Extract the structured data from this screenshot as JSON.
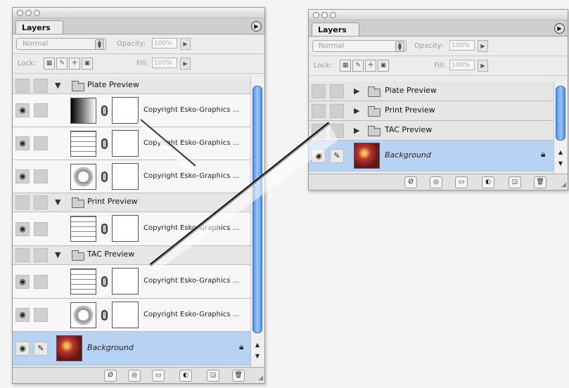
{
  "left_panel": {
    "tab": "Layers",
    "blend_mode": "Normal",
    "opacity_label": "Opacity:",
    "opacity_value": "100%",
    "lock_label": "Lock:",
    "fill_label": "Fill:",
    "fill_value": "100%",
    "groups": [
      {
        "name": "Plate Preview",
        "layers": [
          "Copyright Esko-Graphics ...",
          "Copyright Esko-Graphics ...",
          "Copyright Esko-Graphics ..."
        ]
      },
      {
        "name": "Print Preview",
        "layers": [
          "Copyright Esko-Graphics ..."
        ]
      },
      {
        "name": "TAC Preview",
        "layers": [
          "Copyright Esko-Graphics ...",
          "Copyright Esko-Graphics ..."
        ]
      }
    ],
    "background_layer": "Background"
  },
  "right_panel": {
    "tab": "Layers",
    "blend_mode": "Normal",
    "opacity_label": "Opacity:",
    "opacity_value": "100%",
    "lock_label": "Lock:",
    "fill_label": "Fill:",
    "fill_value": "100%",
    "groups": [
      "Plate Preview",
      "Print Preview",
      "TAC Preview"
    ],
    "background_layer": "Background"
  },
  "icons": {
    "menu": "menu-arrow-icon",
    "eye": "eye-icon",
    "brush": "brush-icon",
    "lock": "lock-icon",
    "folder": "folder-icon",
    "link": "link-chain-icon",
    "trash": "trash-icon"
  },
  "colors": {
    "selection": "#b8d2f4",
    "scroll_thumb": "#4c8fe8"
  }
}
